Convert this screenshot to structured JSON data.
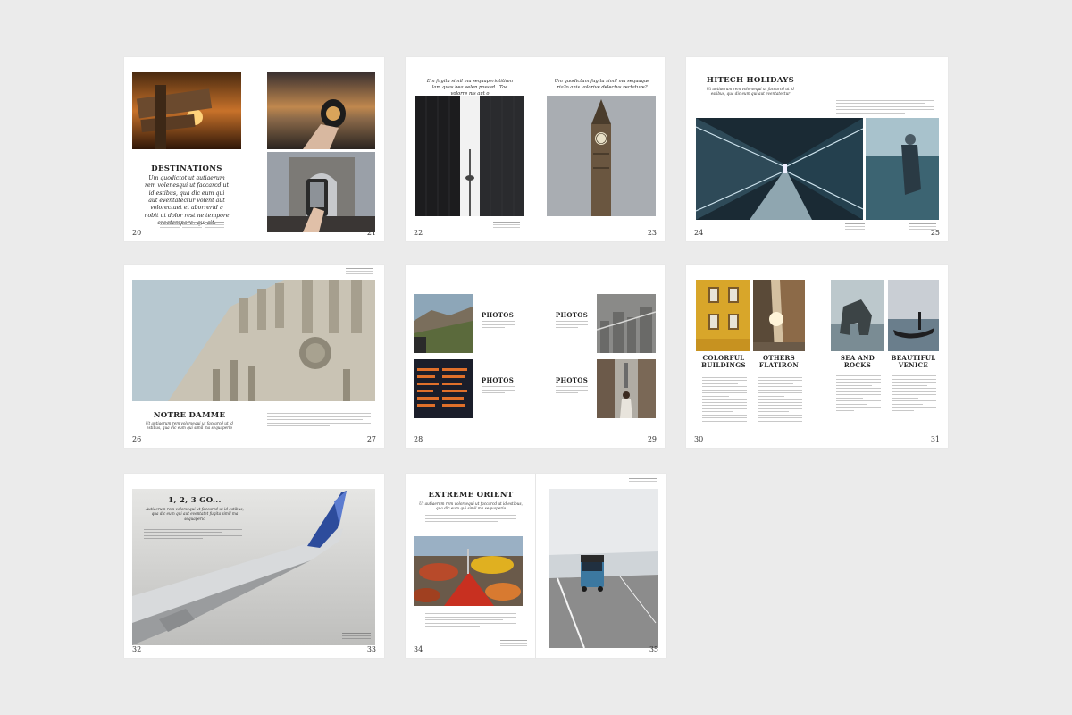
{
  "pages": {
    "p20": "20",
    "p21": "21",
    "p22": "22",
    "p23": "23",
    "p24": "24",
    "p25": "25",
    "p26": "26",
    "p27": "27",
    "p28": "28",
    "p29": "29",
    "p30": "30",
    "p31": "31",
    "p32": "32",
    "p33": "33",
    "p34": "34",
    "p35": "35"
  },
  "spread1": {
    "title": "DESTINATIONS",
    "lead": "Um quodictot ut autiaerum rem volenesqui ut faccarcd ut id estibus, qua dic eum qui aut eventatectur volent aut volorectuet et aborrerid q nobit ut dolor rest ne tempore erectempore, qui sit."
  },
  "spread2": {
    "quote_left": "Em fugita simil ma sequaperiotitium lam quas bea velen possed . Tae volorre nis aut o",
    "quote_right": "Um quodictum fugita simil ma sequaque ria?o anis volorive delectus rectature?"
  },
  "spread3": {
    "title": "HITECH HOLIDAYS",
    "sub": "Ut autiaerum rem volorsequi ut faccarcd ut id estibus, qua dic eum qui aut eventatectur"
  },
  "spread4": {
    "title": "NOTRE DAMME",
    "sub": "Ut autiaerum rem volorsequi ut faccarcd ut id estibus, qua dic eum qui simil ma sequaperio"
  },
  "spread5": {
    "photos_1": "PHOTOS",
    "photos_2": "PHOTOS",
    "photos_3": "PHOTOS",
    "photos_4": "PHOTOS"
  },
  "spread6": {
    "col1": "COLORFUL BUILDINGS",
    "col2": "OTHERS FLATIRON",
    "col3": "SEA AND ROCKS",
    "col4": "BEAUTIFUL VENICE"
  },
  "spread7": {
    "title": "1, 2, 3 GO...",
    "sub": "Autiaerum rem volorsequi ut faccarcd ut id estibus, qua dic eum qui aut eventatet fugita simil ma sequaperio"
  },
  "spread8": {
    "title": "EXTREME ORIENT",
    "sub": "Ut autiaerum rem volorsequi ut faccarcd ut id estibus, qua dic eum qui simil ma sequaperio"
  },
  "colors": {
    "background": "#ebebeb",
    "page": "#ffffff"
  }
}
